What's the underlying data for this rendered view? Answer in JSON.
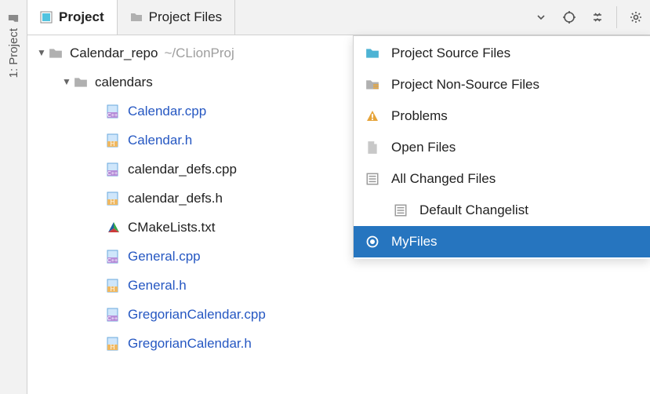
{
  "toolWindow": {
    "label": "1: Project"
  },
  "tabs": {
    "project": "Project",
    "projectFiles": "Project Files"
  },
  "tree": {
    "root": {
      "name": "Calendar_repo",
      "hint": "~/CLionProj"
    },
    "folder": {
      "name": "calendars"
    },
    "files": [
      {
        "name": "Calendar.cpp",
        "kind": "cpp",
        "linked": true
      },
      {
        "name": "Calendar.h",
        "kind": "h",
        "linked": true
      },
      {
        "name": "calendar_defs.cpp",
        "kind": "cpp",
        "linked": false
      },
      {
        "name": "calendar_defs.h",
        "kind": "h",
        "linked": false
      },
      {
        "name": "CMakeLists.txt",
        "kind": "cmake",
        "linked": false
      },
      {
        "name": "General.cpp",
        "kind": "cpp",
        "linked": true
      },
      {
        "name": "General.h",
        "kind": "h",
        "linked": true
      },
      {
        "name": "GregorianCalendar.cpp",
        "kind": "cpp",
        "linked": true
      },
      {
        "name": "GregorianCalendar.h",
        "kind": "h",
        "linked": true
      }
    ]
  },
  "popup": {
    "items": [
      {
        "label": "Project Source Files"
      },
      {
        "label": "Project Non-Source Files"
      },
      {
        "label": "Problems"
      },
      {
        "label": "Open Files"
      },
      {
        "label": "All Changed Files"
      },
      {
        "label": "Default Changelist",
        "indent": true
      },
      {
        "label": "MyFiles",
        "selected": true
      }
    ]
  }
}
